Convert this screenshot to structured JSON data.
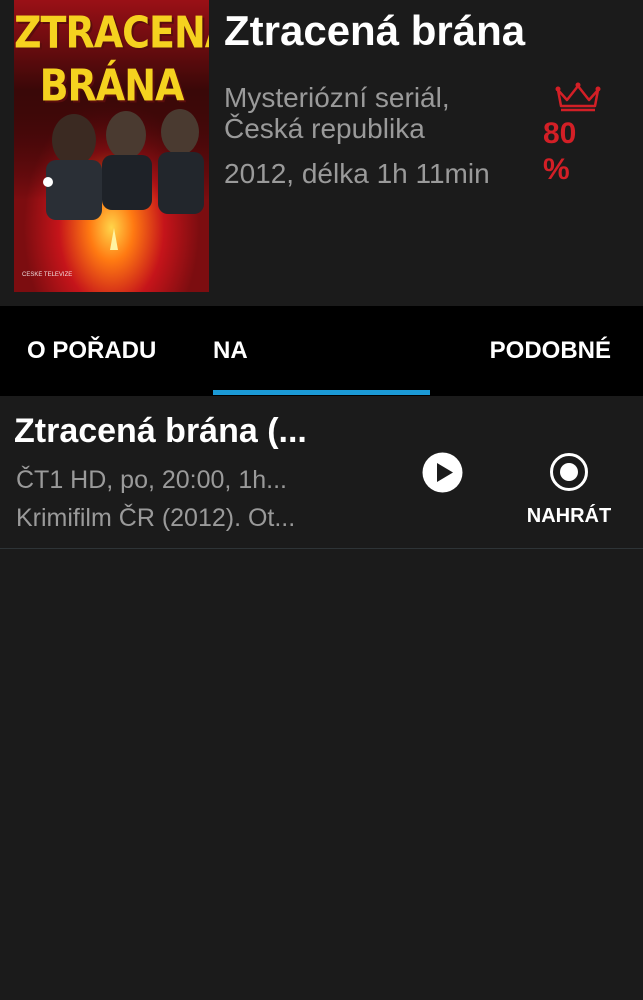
{
  "show": {
    "title": "Ztracená brána",
    "genre": "Mysteriózní seriál,",
    "country": "Česká republika",
    "year_length": "2012, délka 1h 11min",
    "rating_number": "80",
    "rating_unit": "%",
    "poster": {
      "title_line1": "ZTRACENÁ",
      "title_line2": "BRÁNA",
      "logo": "ČESKÉ TELEVIZE"
    }
  },
  "tabs": [
    {
      "label": "O POŘADU"
    },
    {
      "label": "NA"
    },
    {
      "label": "PODOBNÉ"
    }
  ],
  "broadcasts": [
    {
      "title": "Ztracená brána (...",
      "line1": "ČT1 HD, po, 20:00, 1h...",
      "line2": "Krimifilm ČR (2012). Ot...",
      "record_label": "NAHRÁT"
    }
  ],
  "colors": {
    "background": "#1b1b1b",
    "tabbar": "#000000",
    "accent": "#1b9ad6",
    "rating": "#d31f26",
    "secondary_text": "#9a9a9a"
  },
  "icons": {
    "rating": "crown-icon",
    "play": "play-icon",
    "record": "record-icon"
  }
}
